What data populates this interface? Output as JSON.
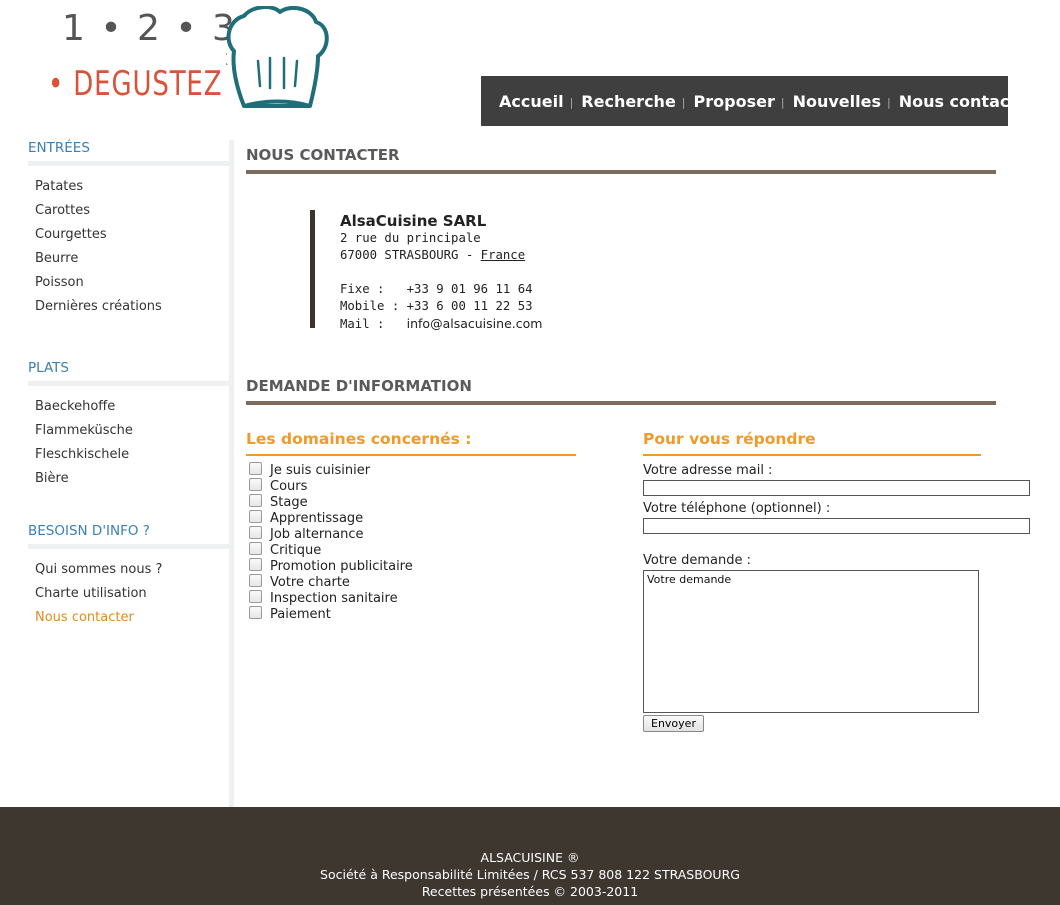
{
  "logo": {
    "digits": "1 • 2 • 3",
    "brand": "• DEGUSTEZ"
  },
  "nav": {
    "items": [
      "Accueil",
      "Recherche",
      "Proposer",
      "Nouvelles",
      "Nous contacter"
    ],
    "separator": "|"
  },
  "sidebar": {
    "groups": [
      {
        "heading": "ENTRÉES",
        "items": [
          "Patates",
          "Carottes",
          "Courgettes",
          "Beurre",
          "Poisson",
          "Dernières créations"
        ]
      },
      {
        "heading": "PLATS",
        "items": [
          "Baeckehoffe",
          "Flammeküsche",
          "Fleschkischele",
          "Bière"
        ]
      },
      {
        "heading": "BESOISN D'INFO ?",
        "items": [
          "Qui sommes nous ?",
          "Charte utilisation",
          "Nous contacter"
        ]
      }
    ],
    "active_item": "Nous contacter"
  },
  "contact": {
    "section_title": "NOUS CONTACTER",
    "company": "AlsaCuisine SARL",
    "street": "2 rue du principale",
    "city": "67000 STRASBOURG - ",
    "country": "France",
    "phone_label": "Fixe :   ",
    "phone": "+33 9 01 96 11 64",
    "mobile_label": "Mobile : ",
    "mobile": "+33 6 00 11 22 53",
    "mail_label": "Mail :   ",
    "mail": "info@alsacuisine.com"
  },
  "form": {
    "section_title": "DEMANDE D'INFORMATION",
    "domains_title": "Les domaines concernés :",
    "domains": [
      "Je suis cuisinier",
      "Cours",
      "Stage",
      "Apprentissage",
      "Job alternance",
      "Critique",
      "Promotion publicitaire",
      "Votre charte",
      "Inspection sanitaire",
      "Paiement"
    ],
    "reply_title": "Pour vous répondre",
    "email_label": "Votre adresse mail :",
    "email_value": "",
    "phone_label": "Votre téléphone (optionnel) :",
    "phone_value": "",
    "request_label": "Votre demande :",
    "request_value": "Votre demande",
    "send_label": "Envoyer"
  },
  "footer": {
    "line1": "ALSACUISINE ®",
    "line2": "Société à Responsabilité Limitées / RCS 537 808 122 STRASBOURG",
    "line3": "Recettes présentées © 2003-2011"
  },
  "colors": {
    "nav_bg": "#3f3f3f",
    "sidebar_heading": "#3a7fb5",
    "accent_orange": "#f09a2a",
    "active_link": "#e08a1e",
    "section_rule": "#7a6b5a",
    "footer_bg": "#3e3730",
    "logo_red": "#d9533a",
    "hat_teal": "#1f6e7a"
  }
}
